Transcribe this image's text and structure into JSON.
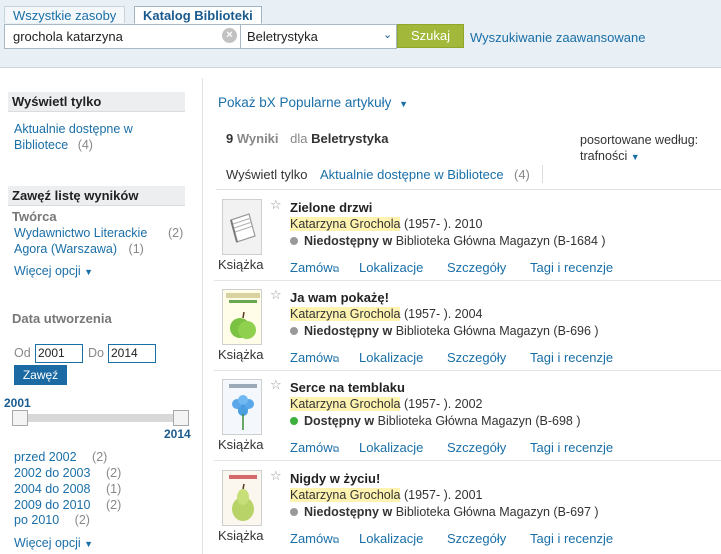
{
  "header": {
    "tabs": [
      "Wszystkie zasoby",
      "Katalog Biblioteki"
    ],
    "search_value": "grochola katarzyna",
    "scope_value": "Beletrystyka",
    "search_button": "Szukaj",
    "advanced_link": "Wyszukiwanie zaawansowane"
  },
  "sidebar": {
    "show_only": {
      "heading": "Wyświetl tylko",
      "item_line1": "Aktualnie dostępne w",
      "item_line2": "Bibliotece",
      "item_count": "(4)"
    },
    "narrow": {
      "heading": "Zawęź listę wyników",
      "creator_label": "Twórca",
      "creators": [
        {
          "name": "Wydawnictwo Literackie",
          "count": "(2)"
        },
        {
          "name": "Agora (Warszawa)",
          "count": "(1)"
        }
      ],
      "more_options": "Więcej opcji"
    },
    "date": {
      "label": "Data utworzenia",
      "from_label": "Od",
      "from_value": "2001",
      "to_label": "Do",
      "to_value": "2014",
      "apply_button": "Zawęź",
      "slider_min_label": "2001",
      "slider_max_label": "2014",
      "ranges": [
        {
          "label": "przed 2002",
          "count": "(2)"
        },
        {
          "label": "2002 do 2003",
          "count": "(2)"
        },
        {
          "label": "2004 do 2008",
          "count": "(1)"
        },
        {
          "label": "2009 do 2010",
          "count": "(2)"
        },
        {
          "label": "po 2010",
          "count": "(2)"
        }
      ],
      "more_options": "Więcej opcji"
    }
  },
  "main": {
    "popular_link": "Pokaż bX Popularne artykuły",
    "results_count": "9",
    "results_word": "Wyniki",
    "results_for": "dla",
    "results_scope": "Beletrystyka",
    "sort_label": "posortowane według:",
    "sort_value": "trafności",
    "filter_label": "Wyświetl tylko",
    "filter_link": "Aktualnie dostępne w Bibliotece",
    "filter_count": "(4)",
    "results": [
      {
        "title": "Zielone drzwi",
        "author": "Katarzyna Grochola",
        "dates": "(1957- ). 2010",
        "status": "Niedostępny w",
        "status_color": "#999999",
        "location": "Biblioteka Główna Magazyn (B-1684 )",
        "type": "Książka",
        "cover": "placeholder-book-icon"
      },
      {
        "title": "Ja wam pokażę!",
        "author": "Katarzyna Grochola",
        "dates": "(1957- ). 2004",
        "status": "Niedostępny w",
        "status_color": "#999999",
        "location": "Biblioteka Główna Magazyn (B-696 )",
        "type": "Książka",
        "cover": "apple-cover"
      },
      {
        "title": "Serce na temblaku",
        "author": "Katarzyna Grochola",
        "dates": "(1957- ). 2002",
        "status": "Dostępny w",
        "status_color": "#3bb03b",
        "location": "Biblioteka Główna Magazyn (B-698 )",
        "type": "Książka",
        "cover": "flower-cover"
      },
      {
        "title": "Nigdy w życiu!",
        "author": "Katarzyna Grochola",
        "dates": "(1957- ). 2001",
        "status": "Niedostępny w",
        "status_color": "#999999",
        "location": "Biblioteka Główna Magazyn (B-697 )",
        "type": "Książka",
        "cover": "pear-cover"
      }
    ],
    "actions": [
      "Zamów",
      "Lokalizacje",
      "Szczegóły",
      "Tagi i recenzje"
    ]
  }
}
